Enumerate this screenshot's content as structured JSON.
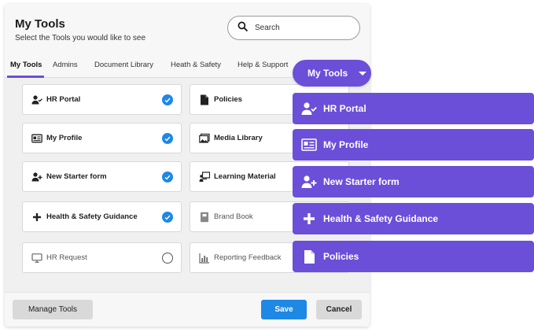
{
  "header": {
    "title": "My Tools",
    "subtitle": "Select the Tools you would like to see",
    "search_placeholder": "Search"
  },
  "tabs": [
    {
      "label": "My Tools",
      "active": true
    },
    {
      "label": "Admins"
    },
    {
      "label": "Document Library"
    },
    {
      "label": "Heath & Safety"
    },
    {
      "label": "Help & Support"
    }
  ],
  "tools_left": [
    {
      "label": "HR Portal",
      "icon": "user-check-icon",
      "selected": true
    },
    {
      "label": "My Profile",
      "icon": "id-card-icon",
      "selected": true
    },
    {
      "label": "New Starter form",
      "icon": "user-plus-icon",
      "selected": true
    },
    {
      "label": "Health & Safety Guidance",
      "icon": "plus-icon",
      "selected": true
    },
    {
      "label": "HR Request",
      "icon": "monitor-icon",
      "selected": false
    }
  ],
  "tools_right": [
    {
      "label": "Policies",
      "icon": "document-icon",
      "selected": true
    },
    {
      "label": "Media Library",
      "icon": "image-gallery-icon",
      "selected": false
    },
    {
      "label": "Learning Material",
      "icon": "presentation-icon",
      "selected": false
    },
    {
      "label": "Brand Book",
      "icon": "book-icon",
      "selected": false
    },
    {
      "label": "Reporting Feedback",
      "icon": "bar-chart-icon",
      "selected": false
    }
  ],
  "footer": {
    "manage_label": "Manage Tools",
    "save_label": "Save",
    "cancel_label": "Cancel"
  },
  "dropdown": {
    "label": "My Tools",
    "items": [
      {
        "label": "HR Portal",
        "icon": "user-check-icon"
      },
      {
        "label": "My Profile",
        "icon": "id-card-icon"
      },
      {
        "label": "New Starter form",
        "icon": "user-plus-icon"
      },
      {
        "label": "Health & Safety Guidance",
        "icon": "plus-icon"
      },
      {
        "label": "Policies",
        "icon": "document-icon"
      }
    ]
  },
  "colors": {
    "accent_purple": "#6b4fd8",
    "check_blue": "#1e88e5",
    "panel_bg": "#f0f0f0"
  }
}
